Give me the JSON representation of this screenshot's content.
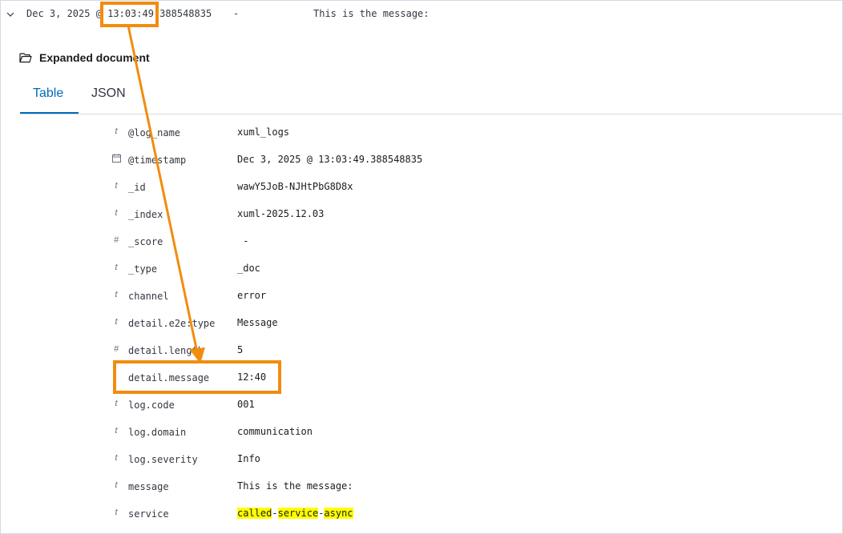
{
  "top_row": {
    "timestamp": "Dec 3, 2025 @ 13:03:49.388548835",
    "dash": "-",
    "message": "This is the message:"
  },
  "expanded": {
    "title": "Expanded document"
  },
  "tabs": {
    "table": "Table",
    "json": "JSON"
  },
  "fields": [
    {
      "type": "t",
      "name": "@log_name",
      "value": "xuml_logs"
    },
    {
      "type": "calendar",
      "name": "@timestamp",
      "value": "Dec 3, 2025 @ 13:03:49.388548835"
    },
    {
      "type": "t",
      "name": "_id",
      "value": "wawY5JoB-NJHtPbG8D8x"
    },
    {
      "type": "t",
      "name": "_index",
      "value": "xuml-2025.12.03"
    },
    {
      "type": "#",
      "name": "_score",
      "value": " -"
    },
    {
      "type": "t",
      "name": "_type",
      "value": "_doc"
    },
    {
      "type": "t",
      "name": "channel",
      "value": "error"
    },
    {
      "type": "t",
      "name": "detail.e2e:type",
      "value": "Message"
    },
    {
      "type": "#",
      "name": "detail.length",
      "value": "5"
    },
    {
      "type": "",
      "name": "detail.message",
      "value": "12:40"
    },
    {
      "type": "t",
      "name": "log.code",
      "value": "001"
    },
    {
      "type": "t",
      "name": "log.domain",
      "value": "communication"
    },
    {
      "type": "t",
      "name": "log.severity",
      "value": "Info"
    },
    {
      "type": "t",
      "name": "message",
      "value": "This is the message:"
    },
    {
      "type": "t",
      "name": "service",
      "value_parts": [
        "called",
        "-",
        "service",
        "-",
        "async"
      ]
    }
  ],
  "colors": {
    "accent": "#006bb8",
    "annotation": "#f28c0f",
    "highlight": "#ffff00"
  }
}
